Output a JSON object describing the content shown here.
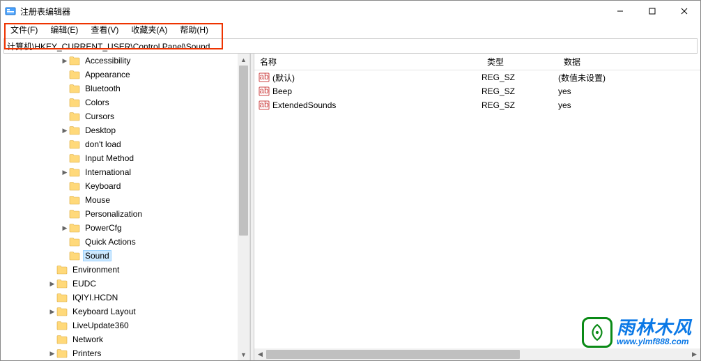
{
  "window": {
    "title": "注册表编辑器",
    "minimize": "—",
    "maximize": "□",
    "close": "✕"
  },
  "menu": {
    "file": "文件(F)",
    "edit": "编辑(E)",
    "view": "查看(V)",
    "favorites": "收藏夹(A)",
    "help": "帮助(H)"
  },
  "address": {
    "path": "计算机\\HKEY_CURRENT_USER\\Control Panel\\Sound"
  },
  "tree": {
    "items": [
      {
        "indent": 3,
        "exp": "right",
        "label": "Accessibility",
        "selected": false
      },
      {
        "indent": 3,
        "exp": "",
        "label": "Appearance",
        "selected": false
      },
      {
        "indent": 3,
        "exp": "",
        "label": "Bluetooth",
        "selected": false
      },
      {
        "indent": 3,
        "exp": "",
        "label": "Colors",
        "selected": false
      },
      {
        "indent": 3,
        "exp": "",
        "label": "Cursors",
        "selected": false
      },
      {
        "indent": 3,
        "exp": "right",
        "label": "Desktop",
        "selected": false
      },
      {
        "indent": 3,
        "exp": "",
        "label": "don't load",
        "selected": false
      },
      {
        "indent": 3,
        "exp": "",
        "label": "Input Method",
        "selected": false
      },
      {
        "indent": 3,
        "exp": "right",
        "label": "International",
        "selected": false
      },
      {
        "indent": 3,
        "exp": "",
        "label": "Keyboard",
        "selected": false
      },
      {
        "indent": 3,
        "exp": "",
        "label": "Mouse",
        "selected": false
      },
      {
        "indent": 3,
        "exp": "",
        "label": "Personalization",
        "selected": false
      },
      {
        "indent": 3,
        "exp": "right",
        "label": "PowerCfg",
        "selected": false
      },
      {
        "indent": 3,
        "exp": "",
        "label": "Quick Actions",
        "selected": false
      },
      {
        "indent": 3,
        "exp": "",
        "label": "Sound",
        "selected": true
      },
      {
        "indent": 2,
        "exp": "",
        "label": "Environment",
        "selected": false
      },
      {
        "indent": 2,
        "exp": "right",
        "label": "EUDC",
        "selected": false
      },
      {
        "indent": 2,
        "exp": "",
        "label": "IQIYI.HCDN",
        "selected": false
      },
      {
        "indent": 2,
        "exp": "right",
        "label": "Keyboard Layout",
        "selected": false
      },
      {
        "indent": 2,
        "exp": "",
        "label": "LiveUpdate360",
        "selected": false
      },
      {
        "indent": 2,
        "exp": "",
        "label": "Network",
        "selected": false
      },
      {
        "indent": 2,
        "exp": "right",
        "label": "Printers",
        "selected": false
      }
    ]
  },
  "columns": {
    "name": "名称",
    "type": "类型",
    "data": "数据"
  },
  "values": [
    {
      "name": "(默认)",
      "type": "REG_SZ",
      "data": "(数值未设置)"
    },
    {
      "name": "Beep",
      "type": "REG_SZ",
      "data": "yes"
    },
    {
      "name": "ExtendedSounds",
      "type": "REG_SZ",
      "data": "yes"
    }
  ],
  "watermark": {
    "text": "雨林木风",
    "url": "www.ylmf888.com"
  }
}
